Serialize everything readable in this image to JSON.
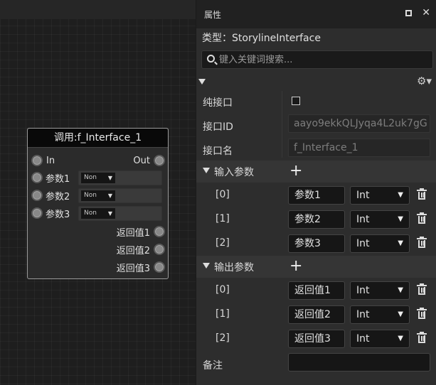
{
  "node": {
    "title": "调用:f_Interface_1",
    "in_label": "In",
    "out_label": "Out",
    "params": [
      {
        "label": "参数1",
        "type": "Non"
      },
      {
        "label": "参数2",
        "type": "Non"
      },
      {
        "label": "参数3",
        "type": "Non"
      }
    ],
    "returns": [
      "返回值1",
      "返回值2",
      "返回值3"
    ]
  },
  "panel": {
    "title": "属性",
    "type_line": "类型：StorylineInterface",
    "search_placeholder": "键入关键词搜索...",
    "pure_interface_label": "纯接口",
    "interface_id_label": "接口ID",
    "interface_id_value": "aayo9ekkQLJyqa4L2uk7gG",
    "interface_name_label": "接口名",
    "interface_name_value": "f_Interface_1",
    "input_section": "输入参数",
    "output_section": "输出参数",
    "inputs": [
      {
        "index": "[0]",
        "name": "参数1",
        "type": "Int"
      },
      {
        "index": "[1]",
        "name": "参数2",
        "type": "Int"
      },
      {
        "index": "[2]",
        "name": "参数3",
        "type": "Int"
      }
    ],
    "outputs": [
      {
        "index": "[0]",
        "name": "返回值1",
        "type": "Int"
      },
      {
        "index": "[1]",
        "name": "返回值2",
        "type": "Int"
      },
      {
        "index": "[2]",
        "name": "返回值3",
        "type": "Int"
      }
    ],
    "note_label": "备注"
  }
}
